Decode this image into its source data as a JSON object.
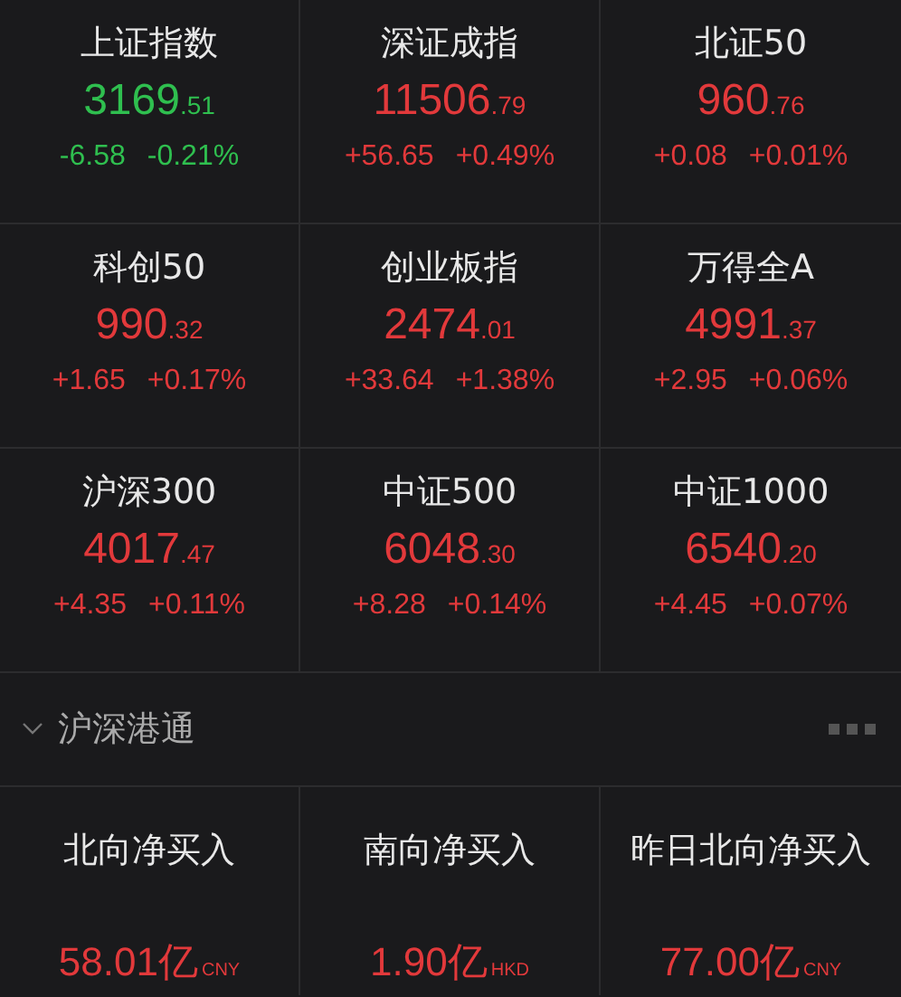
{
  "indices": [
    {
      "name": "上证指数",
      "price": "3169",
      "decimals": ".51",
      "change": "-6.58",
      "percent": "-0.21%",
      "color": "#2fbf4f"
    },
    {
      "name": "深证成指",
      "price": "11506",
      "decimals": ".79",
      "change": "+56.65",
      "percent": "+0.49%",
      "color": "#e2393b"
    },
    {
      "name": "北证50",
      "price": "960",
      "decimals": ".76",
      "change": "+0.08",
      "percent": "+0.01%",
      "color": "#e2393b"
    },
    {
      "name": "科创50",
      "price": "990",
      "decimals": ".32",
      "change": "+1.65",
      "percent": "+0.17%",
      "color": "#e2393b"
    },
    {
      "name": "创业板指",
      "price": "2474",
      "decimals": ".01",
      "change": "+33.64",
      "percent": "+1.38%",
      "color": "#e2393b"
    },
    {
      "name": "万得全A",
      "price": "4991",
      "decimals": ".37",
      "change": "+2.95",
      "percent": "+0.06%",
      "color": "#e2393b"
    },
    {
      "name": "沪深300",
      "price": "4017",
      "decimals": ".47",
      "change": "+4.35",
      "percent": "+0.11%",
      "color": "#e2393b"
    },
    {
      "name": "中证500",
      "price": "6048",
      "decimals": ".30",
      "change": "+8.28",
      "percent": "+0.14%",
      "color": "#e2393b"
    },
    {
      "name": "中证1000",
      "price": "6540",
      "decimals": ".20",
      "change": "+4.45",
      "percent": "+0.07%",
      "color": "#e2393b"
    }
  ],
  "section": {
    "title": "沪深港通",
    "expanded": true
  },
  "flows": [
    {
      "label": "北向净买入",
      "value": "58.01亿",
      "unit": "CNY",
      "color": "#e2393b"
    },
    {
      "label": "南向净买入",
      "value": "1.90亿",
      "unit": "HKD",
      "color": "#e2393b"
    },
    {
      "label": "昨日北向净买入",
      "value": "77.00亿",
      "unit": "CNY",
      "color": "#e2393b"
    }
  ]
}
